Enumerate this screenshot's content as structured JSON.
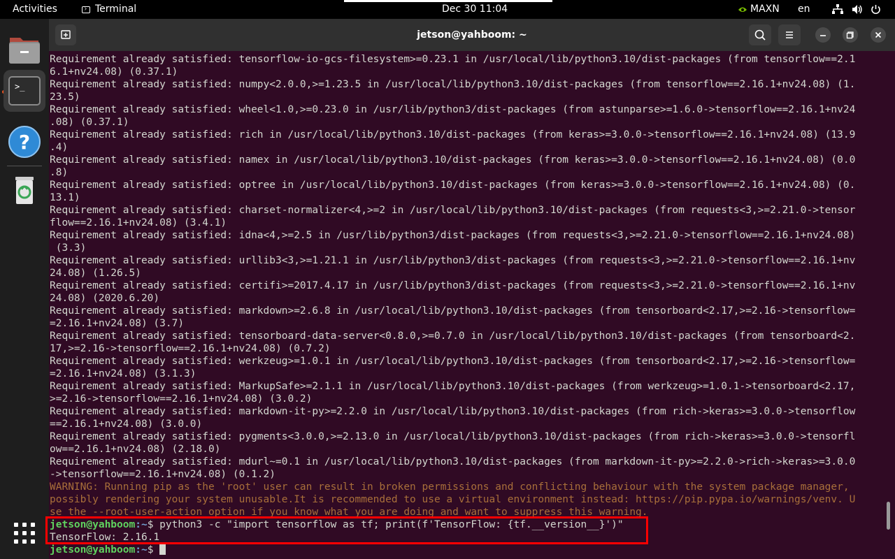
{
  "topbar": {
    "activities": "Activities",
    "app_name": "Terminal",
    "clock": "Dec 30  11:04",
    "power_mode": "MAXN",
    "language": "en"
  },
  "window": {
    "title": "jetson@yahboom: ~"
  },
  "terminal": {
    "lines": [
      {
        "text": "Requirement already satisfied: tensorflow-io-gcs-filesystem>=0.23.1 in /usr/local/lib/python3.10/dist-packages (from tensorflow==2.1"
      },
      {
        "text": "6.1+nv24.08) (0.37.1)"
      },
      {
        "text": "Requirement already satisfied: numpy<2.0.0,>=1.23.5 in /usr/local/lib/python3.10/dist-packages (from tensorflow==2.16.1+nv24.08) (1."
      },
      {
        "text": "23.5)"
      },
      {
        "text": "Requirement already satisfied: wheel<1.0,>=0.23.0 in /usr/lib/python3/dist-packages (from astunparse>=1.6.0->tensorflow==2.16.1+nv24"
      },
      {
        "text": ".08) (0.37.1)"
      },
      {
        "text": "Requirement already satisfied: rich in /usr/local/lib/python3.10/dist-packages (from keras>=3.0.0->tensorflow==2.16.1+nv24.08) (13.9"
      },
      {
        "text": ".4)"
      },
      {
        "text": "Requirement already satisfied: namex in /usr/local/lib/python3.10/dist-packages (from keras>=3.0.0->tensorflow==2.16.1+nv24.08) (0.0"
      },
      {
        "text": ".8)"
      },
      {
        "text": "Requirement already satisfied: optree in /usr/local/lib/python3.10/dist-packages (from keras>=3.0.0->tensorflow==2.16.1+nv24.08) (0."
      },
      {
        "text": "13.1)"
      },
      {
        "text": "Requirement already satisfied: charset-normalizer<4,>=2 in /usr/local/lib/python3.10/dist-packages (from requests<3,>=2.21.0->tensor"
      },
      {
        "text": "flow==2.16.1+nv24.08) (3.4.1)"
      },
      {
        "text": "Requirement already satisfied: idna<4,>=2.5 in /usr/lib/python3/dist-packages (from requests<3,>=2.21.0->tensorflow==2.16.1+nv24.08)"
      },
      {
        "text": " (3.3)"
      },
      {
        "text": "Requirement already satisfied: urllib3<3,>=1.21.1 in /usr/lib/python3/dist-packages (from requests<3,>=2.21.0->tensorflow==2.16.1+nv"
      },
      {
        "text": "24.08) (1.26.5)"
      },
      {
        "text": "Requirement already satisfied: certifi>=2017.4.17 in /usr/lib/python3/dist-packages (from requests<3,>=2.21.0->tensorflow==2.16.1+nv"
      },
      {
        "text": "24.08) (2020.6.20)"
      },
      {
        "text": "Requirement already satisfied: markdown>=2.6.8 in /usr/local/lib/python3.10/dist-packages (from tensorboard<2.17,>=2.16->tensorflow="
      },
      {
        "text": "=2.16.1+nv24.08) (3.7)"
      },
      {
        "text": "Requirement already satisfied: tensorboard-data-server<0.8.0,>=0.7.0 in /usr/local/lib/python3.10/dist-packages (from tensorboard<2."
      },
      {
        "text": "17,>=2.16->tensorflow==2.16.1+nv24.08) (0.7.2)"
      },
      {
        "text": "Requirement already satisfied: werkzeug>=1.0.1 in /usr/local/lib/python3.10/dist-packages (from tensorboard<2.17,>=2.16->tensorflow="
      },
      {
        "text": "=2.16.1+nv24.08) (3.1.3)"
      },
      {
        "text": "Requirement already satisfied: MarkupSafe>=2.1.1 in /usr/local/lib/python3.10/dist-packages (from werkzeug>=1.0.1->tensorboard<2.17,"
      },
      {
        "text": ">=2.16->tensorflow==2.16.1+nv24.08) (3.0.2)"
      },
      {
        "text": "Requirement already satisfied: markdown-it-py>=2.2.0 in /usr/local/lib/python3.10/dist-packages (from rich->keras>=3.0.0->tensorflow"
      },
      {
        "text": "==2.16.1+nv24.08) (3.0.0)"
      },
      {
        "text": "Requirement already satisfied: pygments<3.0.0,>=2.13.0 in /usr/local/lib/python3.10/dist-packages (from rich->keras>=3.0.0->tensorfl"
      },
      {
        "text": "ow==2.16.1+nv24.08) (2.18.0)"
      },
      {
        "text": "Requirement already satisfied: mdurl~=0.1 in /usr/local/lib/python3.10/dist-packages (from markdown-it-py>=2.2.0->rich->keras>=3.0.0"
      },
      {
        "text": "->tensorflow==2.16.1+nv24.08) (0.1.2)"
      },
      {
        "text": "WARNING: Running pip as the 'root' user can result in broken permissions and conflicting behaviour with the system package manager,",
        "kind": "warn"
      },
      {
        "text": "possibly rendering your system unusable.It is recommended to use a virtual environment instead: https://pip.pypa.io/warnings/venv. U",
        "kind": "warn"
      },
      {
        "text": "se the --root-user-action option if you know what you are doing and want to suppress this warning.",
        "kind": "warn"
      },
      {
        "kind": "prompt",
        "user": "jetson@yahboom",
        "path": ":~",
        "symbol": "$ ",
        "command": "python3 -c \"import tensorflow as tf; print(f'TensorFlow: {tf.__version__}')\""
      },
      {
        "text": "TensorFlow: 2.16.1"
      },
      {
        "kind": "prompt",
        "user": "jetson@yahboom",
        "path": ":~",
        "symbol": "$ ",
        "command": "",
        "cursor": true
      }
    ]
  },
  "colors": {
    "terminal_bg": "#300a24",
    "prompt_user": "#5fd35f",
    "prompt_path": "#729fcf",
    "warning": "#a86f3a",
    "highlight": "#ff0000",
    "accent": "#e95420"
  },
  "icons": {
    "dock": [
      "files-icon",
      "terminal-icon",
      "help-icon",
      "trash-icon",
      "show-apps-icon"
    ],
    "tray": [
      "nvidia-icon",
      "network-icon",
      "volume-icon",
      "power-icon"
    ],
    "header": [
      "new-tab-icon",
      "search-icon",
      "hamburger-menu-icon",
      "minimize-icon",
      "maximize-icon",
      "close-icon"
    ]
  }
}
